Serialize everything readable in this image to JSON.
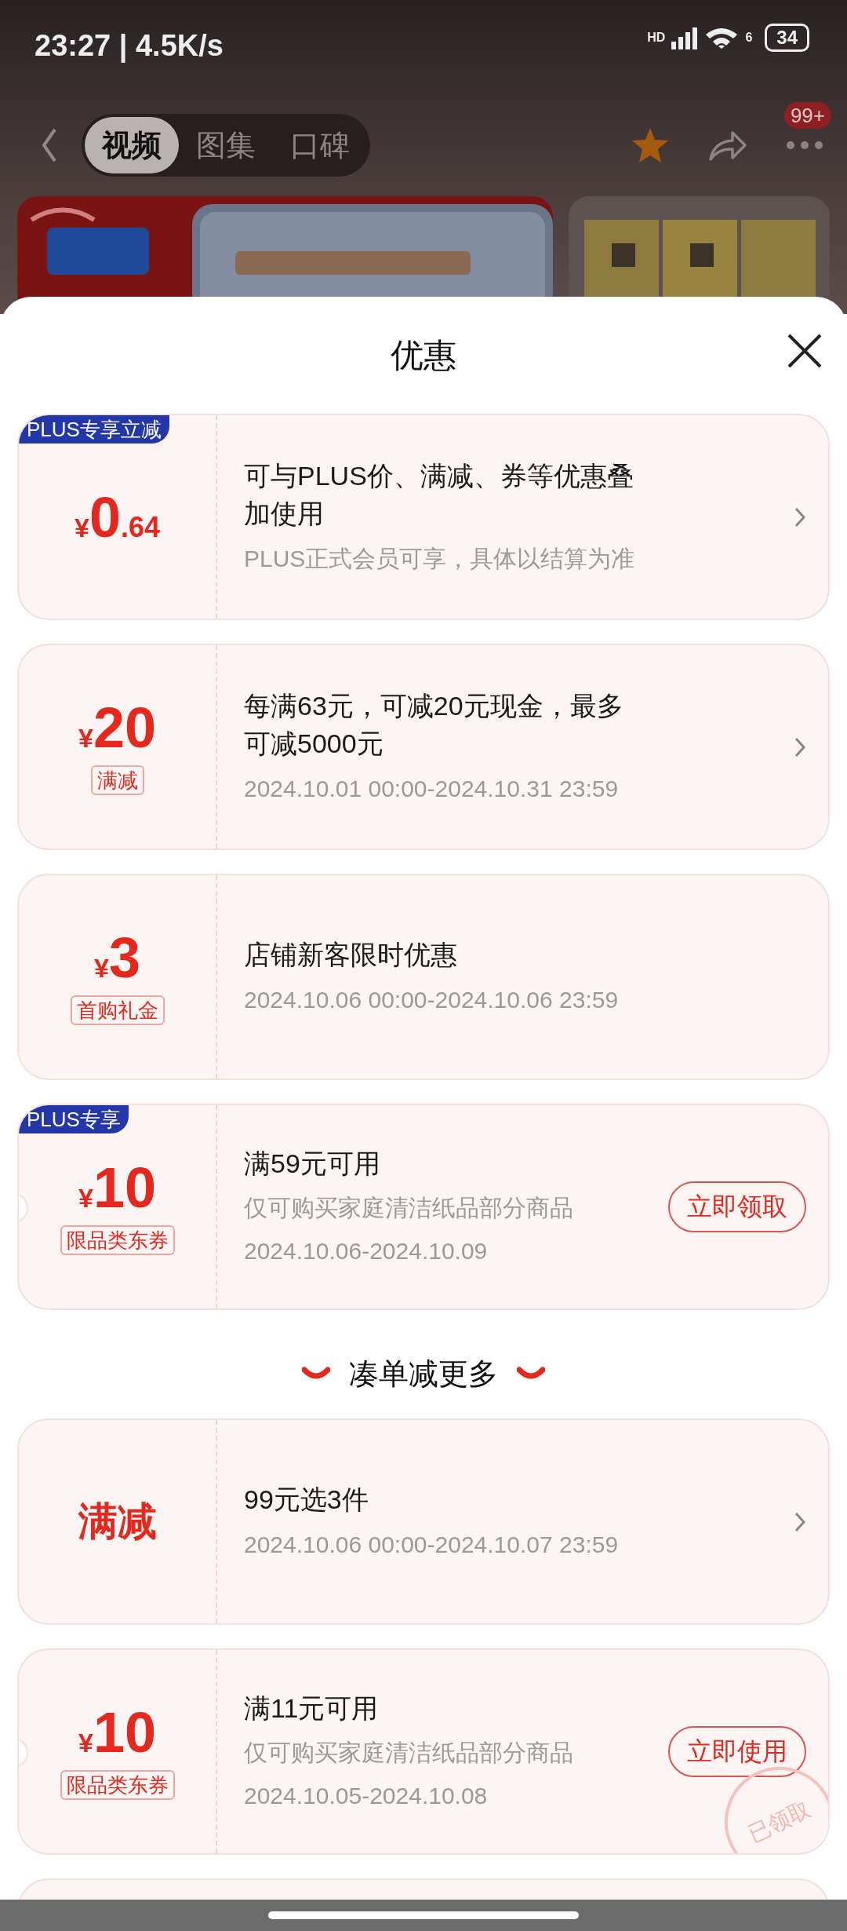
{
  "status_bar": {
    "time": "23:27 | 4.5K/s",
    "network_label": "HD",
    "wifi_label": "6",
    "battery": "34"
  },
  "nav": {
    "tabs": [
      {
        "label": "视频",
        "selected": true
      },
      {
        "label": "图集",
        "selected": false
      },
      {
        "label": "口碑",
        "selected": false
      }
    ],
    "favorited": true,
    "badge": "99+"
  },
  "sheet": {
    "title": "优惠",
    "items": [
      {
        "kind": "coupon",
        "corner_tag": "PLUS专享立减",
        "amount": {
          "currency": "¥",
          "integer": "0",
          "decimal": ".64"
        },
        "title": "可与PLUS价、满减、券等优惠叠加使用",
        "subtitle": "PLUS正式会员可享，具体以结算为准",
        "action": {
          "kind": "chevron"
        }
      },
      {
        "kind": "coupon",
        "amount": {
          "currency": "¥",
          "integer": "20"
        },
        "tag": "满减",
        "title": "每满63元，可减20元现金，最多可减5000元",
        "dates": "2024.10.01 00:00-2024.10.31 23:59",
        "action": {
          "kind": "chevron"
        }
      },
      {
        "kind": "coupon",
        "amount": {
          "currency": "¥",
          "integer": "3"
        },
        "tag": "首购礼金",
        "title": "店铺新客限时优惠",
        "dates": "2024.10.06 00:00-2024.10.06 23:59"
      },
      {
        "kind": "coupon",
        "corner_tag": "PLUS专享",
        "notched": true,
        "amount": {
          "currency": "¥",
          "integer": "10"
        },
        "tag": "限品类东券",
        "title": "满59元可用",
        "subtitle": "仅可购买家庭清洁纸品部分商品",
        "dates": "2024.10.06-2024.10.09",
        "action": {
          "kind": "button",
          "label": "立即领取"
        }
      },
      {
        "kind": "heading",
        "text": "凑单减更多"
      },
      {
        "kind": "coupon",
        "big_label": "满减",
        "title": "99元选3件",
        "dates": "2024.10.06 00:00-2024.10.07 23:59",
        "action": {
          "kind": "chevron"
        }
      },
      {
        "kind": "coupon",
        "notched": true,
        "amount": {
          "currency": "¥",
          "integer": "10"
        },
        "tag": "限品类东券",
        "title": "满11元可用",
        "subtitle": "仅可购买家庭清洁纸品部分商品",
        "dates": "2024.10.05-2024.10.08",
        "action": {
          "kind": "button",
          "label": "立即使用"
        },
        "stamp": "已领取"
      },
      {
        "kind": "peek"
      }
    ]
  }
}
